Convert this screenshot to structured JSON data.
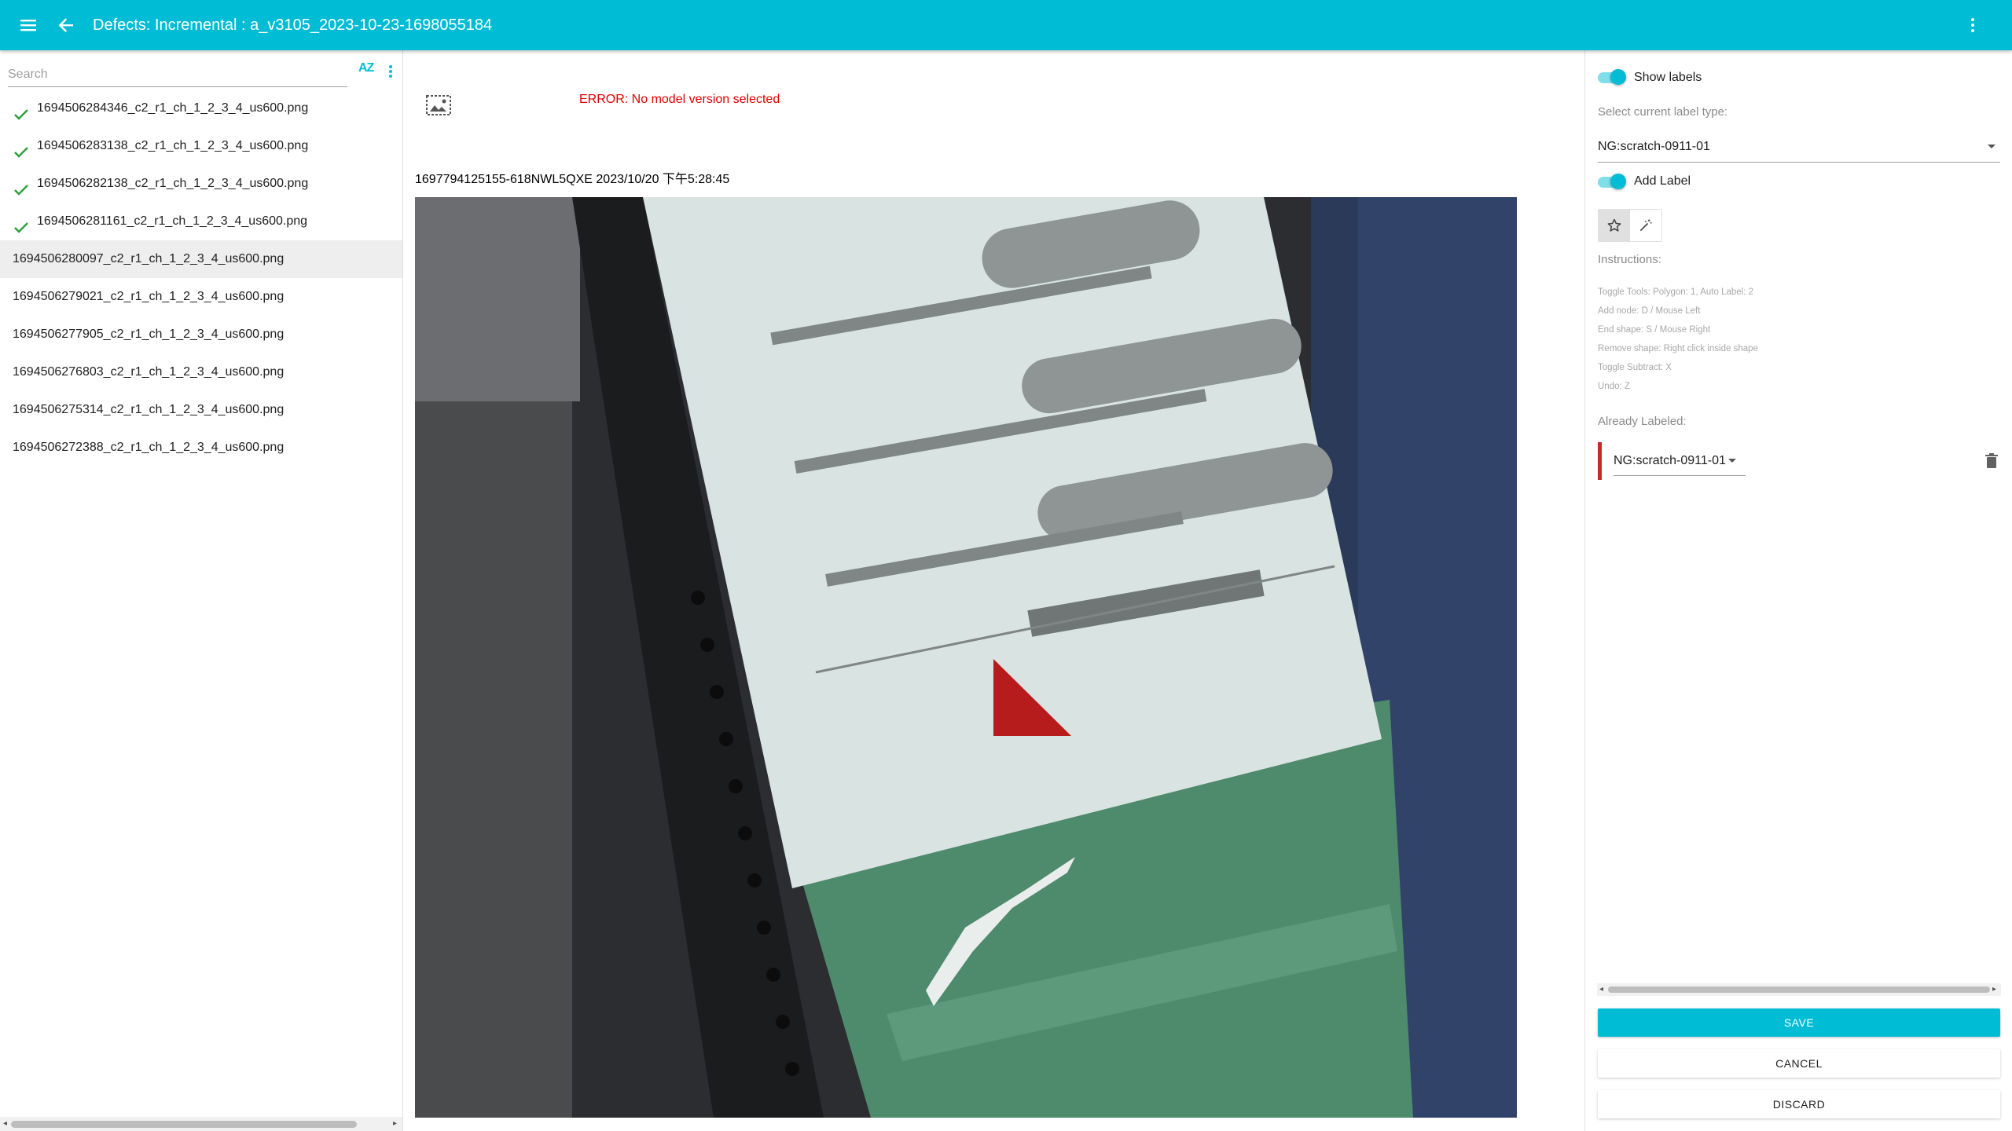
{
  "appbar": {
    "title": "Defects: Incremental : a_v3105_2023-10-23-1698055184",
    "menu_icon": "menu-icon",
    "back_icon": "arrow-back-icon",
    "more_icon": "more-vert-icon"
  },
  "file_list": {
    "search_placeholder": "Search",
    "sort_label": "AZ",
    "items": [
      {
        "name": "1694506284346_c2_r1_ch_1_2_3_4_us600.png",
        "checked": true,
        "selected": false
      },
      {
        "name": "1694506283138_c2_r1_ch_1_2_3_4_us600.png",
        "checked": true,
        "selected": false
      },
      {
        "name": "1694506282138_c2_r1_ch_1_2_3_4_us600.png",
        "checked": true,
        "selected": false
      },
      {
        "name": "1694506281161_c2_r1_ch_1_2_3_4_us600.png",
        "checked": true,
        "selected": false
      },
      {
        "name": "1694506280097_c2_r1_ch_1_2_3_4_us600.png",
        "checked": false,
        "selected": true
      },
      {
        "name": "1694506279021_c2_r1_ch_1_2_3_4_us600.png",
        "checked": false,
        "selected": false
      },
      {
        "name": "1694506277905_c2_r1_ch_1_2_3_4_us600.png",
        "checked": false,
        "selected": false
      },
      {
        "name": "1694506276803_c2_r1_ch_1_2_3_4_us600.png",
        "checked": false,
        "selected": false
      },
      {
        "name": "1694506275314_c2_r1_ch_1_2_3_4_us600.png",
        "checked": false,
        "selected": false
      },
      {
        "name": "1694506272388_c2_r1_ch_1_2_3_4_us600.png",
        "checked": false,
        "selected": false
      }
    ]
  },
  "viewer": {
    "error": "ERROR: No model version selected",
    "caption": "1697794125155-618NWL5QXE 2023/10/20 下午5:28:45",
    "label_color": "#b71c1c"
  },
  "panel": {
    "show_labels": "Show labels",
    "show_labels_on": true,
    "select_type_label": "Select current label type:",
    "current_label_type": "NG:scratch-0911-01",
    "add_label": "Add Label",
    "add_label_on": true,
    "instructions_title": "Instructions:",
    "instructions": [
      "Toggle Tools: Polygon: 1, Auto Label: 2",
      "Add node: D / Mouse Left",
      "End shape: S / Mouse Right",
      "Remove shape: Right click inside shape",
      "Toggle Subtract: X",
      "Undo: Z"
    ],
    "already_labeled": "Already Labeled:",
    "labeled_item": "NG:scratch-0911-01",
    "save": "SAVE",
    "cancel": "CANCEL",
    "discard": "DISCARD"
  },
  "colors": {
    "accent": "#00bcd4",
    "error": "#e00000",
    "label_bar": "#c62828"
  }
}
